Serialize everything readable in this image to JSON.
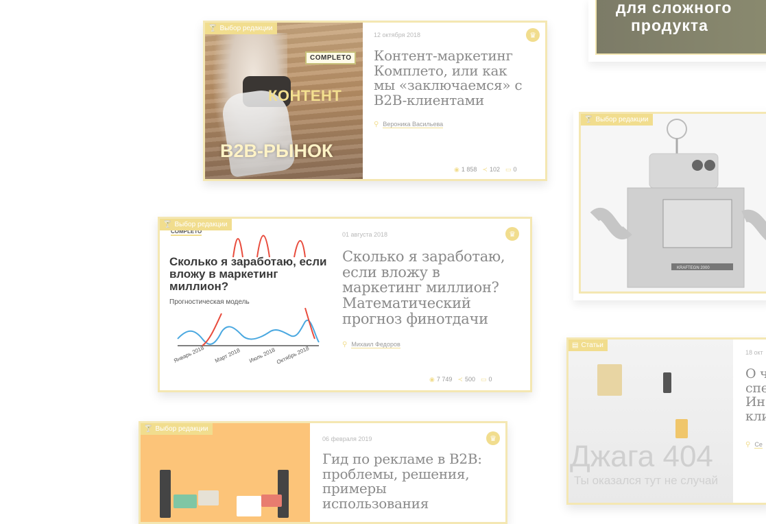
{
  "cards": [
    {
      "badge": "Выбор редакции",
      "date": "12 октября 2018",
      "title": "Контент-маркетинг Комплето, или как мы «заключаемся» с B2B-клиентами",
      "author": "Вероника Васильева",
      "stats": {
        "views": "1 858",
        "shares": "102",
        "comments": "0"
      },
      "image": {
        "logo": "COMPLETO",
        "headline1": "КОНТЕНТ",
        "headline2": "B2B-РЫНОК"
      }
    },
    {
      "badge": "Выбор редакции",
      "date": "01 августа 2018",
      "title": "Сколько я заработаю, если вложу в маркетинг миллион? Математический прогноз финотдачи",
      "author": "Михаил Федоров",
      "stats": {
        "views": "7 749",
        "shares": "500",
        "comments": "0"
      },
      "image": {
        "logo": "COMPLETO",
        "title": "Сколько я заработаю, если вложу в маркетинг миллион?",
        "subtitle": "Прогностическая модель",
        "ticks": [
          "Январь 2018",
          "Март 2018",
          "Июль 2018",
          "Октябрь 2018"
        ]
      }
    },
    {
      "badge": "Выбор редакции",
      "date": "06 февраля 2019",
      "title": "Гид по рекламе в B2B: проблемы, решения, примеры использования"
    }
  ],
  "right": {
    "banner_line1": "для сложного",
    "banner_line2": "продукта",
    "robot_badge": "Выбор редакции",
    "robot_label": "KRAFTEGN 2000",
    "article_badge": "Статьи",
    "article_date": "18 окт",
    "article_title": "О ч спе Ин кли",
    "article_author": "Се",
    "img_big": "Джага 404",
    "img_small": "Ты оказался тут не случай"
  },
  "colors": {
    "accent": "#f1dd8e",
    "border": "#f4e7b2",
    "chart_red": "#e84b3c",
    "chart_blue": "#4aa8e0"
  }
}
